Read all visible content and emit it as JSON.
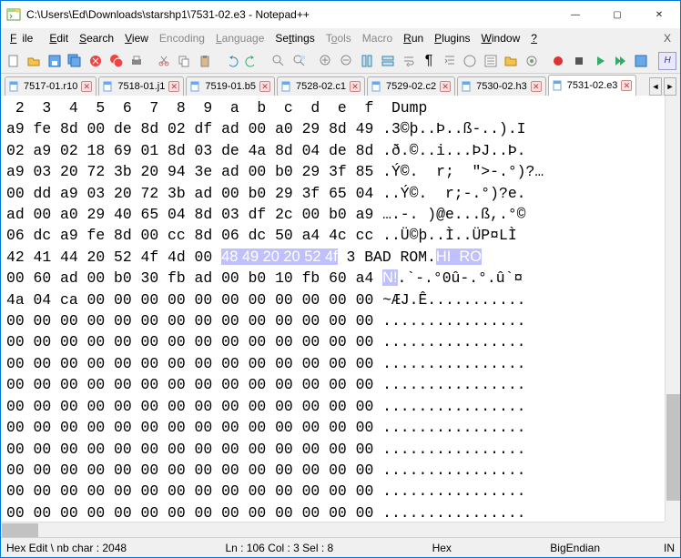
{
  "title": "C:\\Users\\Ed\\Downloads\\starshp1\\7531-02.e3 - Notepad++",
  "win": {
    "min": "—",
    "max": "▢",
    "close": "✕"
  },
  "menu": [
    "File",
    "Edit",
    "Search",
    "View",
    "Encoding",
    "Language",
    "Settings",
    "Tools",
    "Macro",
    "Run",
    "Plugins",
    "Window",
    "?"
  ],
  "help_glyph": "X",
  "tabs": [
    {
      "label": "7517-01.r10"
    },
    {
      "label": "7518-01.j1"
    },
    {
      "label": "7519-01.b5"
    },
    {
      "label": "7528-02.c1"
    },
    {
      "label": "7529-02.c2"
    },
    {
      "label": "7530-02.h3"
    },
    {
      "label": "7531-02.e3",
      "active": true
    }
  ],
  "nav": {
    "left": "◄",
    "right": "►"
  },
  "chart_data": {
    "type": "table",
    "header_cols": [
      "2",
      "3",
      "4",
      "5",
      "6",
      "7",
      "8",
      "9",
      "a",
      "b",
      "c",
      "d",
      "e",
      "f",
      "Dump"
    ],
    "rows": [
      {
        "hex": [
          "a9",
          "fe",
          "8d",
          "00",
          "de",
          "8d",
          "02",
          "df",
          "ad",
          "00",
          "a0",
          "29",
          "8d",
          "49"
        ],
        "dump": ".3©þ..Þ..ß-..).I"
      },
      {
        "hex": [
          "02",
          "a9",
          "02",
          "18",
          "69",
          "01",
          "8d",
          "03",
          "de",
          "4a",
          "8d",
          "04",
          "de",
          "8d"
        ],
        "dump": ".ð.©..i...ÞJ..Þ."
      },
      {
        "hex": [
          "a9",
          "03",
          "20",
          "72",
          "3b",
          "20",
          "94",
          "3e",
          "ad",
          "00",
          "b0",
          "29",
          "3f",
          "85"
        ],
        "dump": ".Ý©.  r;  \">-.°)?…"
      },
      {
        "hex": [
          "00",
          "dd",
          "a9",
          "03",
          "20",
          "72",
          "3b",
          "ad",
          "00",
          "b0",
          "29",
          "3f",
          "65",
          "04"
        ],
        "dump": "..Ý©.  r;-.°)?e."
      },
      {
        "hex": [
          "ad",
          "00",
          "a0",
          "29",
          "40",
          "65",
          "04",
          "8d",
          "03",
          "df",
          "2c",
          "00",
          "b0",
          "a9"
        ],
        "dump": "….-. )@e...ß,.°©"
      },
      {
        "hex": [
          "06",
          "dc",
          "a9",
          "fe",
          "8d",
          "00",
          "cc",
          "8d",
          "06",
          "dc",
          "50",
          "a4",
          "4c",
          "cc"
        ],
        "dump": "..Ü©þ..Ì..ÜP¤LÌ"
      },
      {
        "hex": [
          "42",
          "41",
          "44",
          "20",
          "52",
          "4f",
          "4d",
          "00"
        ],
        "sel": [
          "48",
          "49",
          "20",
          "20",
          "52",
          "4f"
        ],
        "dump_pre": "3 BAD ROM.",
        "dump_sel": "HI  RO"
      },
      {
        "hex": [
          "00",
          "60",
          "ad",
          "00",
          "b0",
          "30",
          "fb",
          "ad",
          "00",
          "b0",
          "10",
          "fb",
          "60",
          "a4"
        ],
        "dump_sel": "N!",
        "dump": ".`-.°0û-.°.û`¤"
      },
      {
        "hex": [
          "4a",
          "04",
          "ca",
          "00",
          "00",
          "00",
          "00",
          "00",
          "00",
          "00",
          "00",
          "00",
          "00",
          "00"
        ],
        "dump": "~ÆJ.Ê..........."
      },
      {
        "hex": [
          "00",
          "00",
          "00",
          "00",
          "00",
          "00",
          "00",
          "00",
          "00",
          "00",
          "00",
          "00",
          "00",
          "00"
        ],
        "dump": "................"
      },
      {
        "hex": [
          "00",
          "00",
          "00",
          "00",
          "00",
          "00",
          "00",
          "00",
          "00",
          "00",
          "00",
          "00",
          "00",
          "00"
        ],
        "dump": "................"
      },
      {
        "hex": [
          "00",
          "00",
          "00",
          "00",
          "00",
          "00",
          "00",
          "00",
          "00",
          "00",
          "00",
          "00",
          "00",
          "00"
        ],
        "dump": "................"
      },
      {
        "hex": [
          "00",
          "00",
          "00",
          "00",
          "00",
          "00",
          "00",
          "00",
          "00",
          "00",
          "00",
          "00",
          "00",
          "00"
        ],
        "dump": "................"
      },
      {
        "hex": [
          "00",
          "00",
          "00",
          "00",
          "00",
          "00",
          "00",
          "00",
          "00",
          "00",
          "00",
          "00",
          "00",
          "00"
        ],
        "dump": "................"
      },
      {
        "hex": [
          "00",
          "00",
          "00",
          "00",
          "00",
          "00",
          "00",
          "00",
          "00",
          "00",
          "00",
          "00",
          "00",
          "00"
        ],
        "dump": "................"
      },
      {
        "hex": [
          "00",
          "00",
          "00",
          "00",
          "00",
          "00",
          "00",
          "00",
          "00",
          "00",
          "00",
          "00",
          "00",
          "00"
        ],
        "dump": "................"
      },
      {
        "hex": [
          "00",
          "00",
          "00",
          "00",
          "00",
          "00",
          "00",
          "00",
          "00",
          "00",
          "00",
          "00",
          "00",
          "00"
        ],
        "dump": "................"
      },
      {
        "hex": [
          "00",
          "00",
          "00",
          "00",
          "00",
          "00",
          "00",
          "00",
          "00",
          "00",
          "00",
          "00",
          "00",
          "00"
        ],
        "dump": "................"
      },
      {
        "hex": [
          "00",
          "00",
          "00",
          "00",
          "00",
          "00",
          "00",
          "00",
          "00",
          "00",
          "00",
          "00",
          "00",
          "00"
        ],
        "dump": "................"
      }
    ]
  },
  "status": {
    "mode": "Hex Edit \\ nb char : 2048",
    "pos": "Ln : 106    Col : 3    Sel : 8",
    "enc": "Hex",
    "endian": "BigEndian",
    "ins": "IN"
  }
}
